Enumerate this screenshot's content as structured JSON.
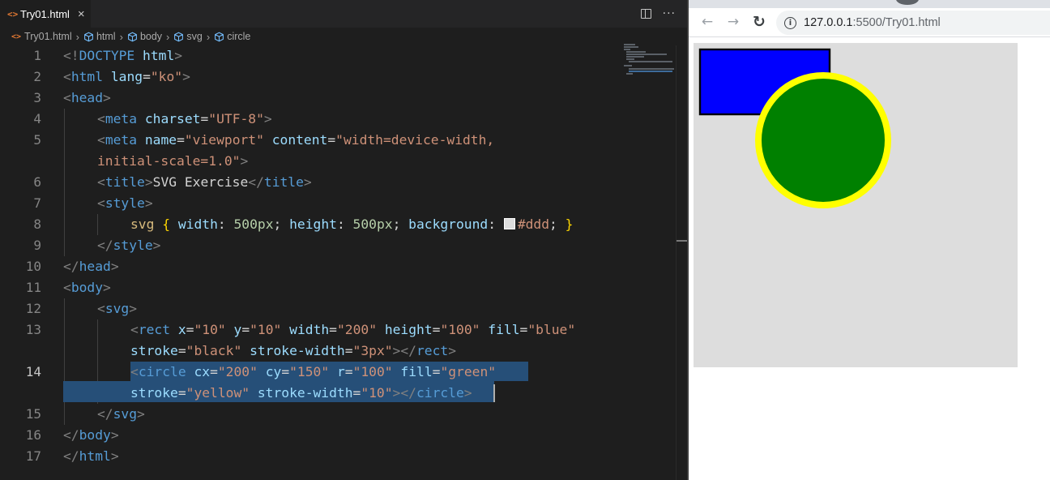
{
  "editor": {
    "tab": {
      "icon": "html-file-icon",
      "label": "Try01.html",
      "close": "×"
    },
    "actions": {
      "split": "split-editor-icon",
      "more": "···"
    },
    "breadcrumb": [
      {
        "label": "Try01.html",
        "icon": "html-file-icon"
      },
      {
        "label": "html",
        "icon": "element-cube-icon"
      },
      {
        "label": "body",
        "icon": "element-cube-icon"
      },
      {
        "label": "svg",
        "icon": "element-cube-icon"
      },
      {
        "label": "circle",
        "icon": "element-cube-icon"
      }
    ],
    "line_numbers": [
      "1",
      "2",
      "3",
      "4",
      "5",
      "6",
      "7",
      "8",
      "9",
      "10",
      "11",
      "12",
      "13",
      "14",
      "15",
      "16",
      "17"
    ],
    "code": {
      "l1": {
        "a": "<!",
        "b": "DOCTYPE",
        "c": " ",
        "d": "html",
        "e": ">"
      },
      "l2": {
        "a": "<",
        "b": "html",
        "c": " ",
        "d": "lang",
        "e": "=",
        "f": "\"ko\"",
        "g": ">"
      },
      "l3": {
        "a": "<",
        "b": "head",
        "c": ">"
      },
      "l4": {
        "a": "<",
        "b": "meta",
        "c": " ",
        "d": "charset",
        "e": "=",
        "f": "\"UTF-8\"",
        "g": ">"
      },
      "l5": {
        "a": "<",
        "b": "meta",
        "c": " ",
        "d": "name",
        "e": "=",
        "f": "\"viewport\"",
        "g": " ",
        "h": "content",
        "i": "=",
        "j": "\"width=device-width,",
        "k": "initial-scale=1.0\"",
        "l": ">"
      },
      "l6": {
        "a": "<",
        "b": "title",
        "c": ">",
        "d": "SVG Exercise",
        "e": "</",
        "f": "title",
        "g": ">"
      },
      "l7": {
        "a": "<",
        "b": "style",
        "c": ">"
      },
      "l8": {
        "a": "svg",
        "b": " ",
        "c": "{",
        "d": " ",
        "e": "width",
        "f": ": ",
        "g": "500px",
        "h": "; ",
        "i": "height",
        "j": ": ",
        "k": "500px",
        "l": "; ",
        "m": "background",
        "n": ": ",
        "o": "#ddd",
        "p": "; ",
        "q": "}"
      },
      "l9": {
        "a": "</",
        "b": "style",
        "c": ">"
      },
      "l10": {
        "a": "</",
        "b": "head",
        "c": ">"
      },
      "l11": {
        "a": "<",
        "b": "body",
        "c": ">"
      },
      "l12": {
        "a": "<",
        "b": "svg",
        "c": ">"
      },
      "l13": {
        "a": "<",
        "b": "rect",
        "c": " ",
        "d": "x",
        "e": "=",
        "f": "\"10\"",
        "g": " ",
        "h": "y",
        "i": "=",
        "j": "\"10\"",
        "k": " ",
        "l": "width",
        "m": "=",
        "n": "\"200\"",
        "o": " ",
        "p": "height",
        "q": "=",
        "r": "\"100\"",
        "s": " ",
        "t": "fill",
        "u": "=",
        "v": "\"blue\""
      },
      "l13b": {
        "a": "stroke",
        "b": "=",
        "c": "\"black\"",
        "d": " ",
        "e": "stroke-width",
        "f": "=",
        "g": "\"3px\"",
        "h": "></",
        "i": "rect",
        "j": ">"
      },
      "l14": {
        "a": "<",
        "b": "circle",
        "c": " ",
        "d": "cx",
        "e": "=",
        "f": "\"200\"",
        "g": " ",
        "h": "cy",
        "i": "=",
        "j": "\"150\"",
        "k": " ",
        "l": "r",
        "m": "=",
        "n": "\"100\"",
        "o": " ",
        "p": "fill",
        "q": "=",
        "r": "\"green\""
      },
      "l14b": {
        "a": "stroke",
        "b": "=",
        "c": "\"yellow\"",
        "d": " ",
        "e": "stroke-width",
        "f": "=",
        "g": "\"10\"",
        "h": "></",
        "i": "circle",
        "j": ">"
      },
      "l15": {
        "a": "</",
        "b": "svg",
        "c": ">"
      },
      "l16": {
        "a": "</",
        "b": "body",
        "c": ">"
      },
      "l17": {
        "a": "</",
        "b": "html",
        "c": ">"
      }
    },
    "colors": {
      "background": "#1e1e1e",
      "tag": "#569cd6",
      "attribute": "#9cdcfe",
      "string": "#ce9178",
      "selection": "#264f78",
      "swatch": "#dddddd"
    }
  },
  "browser": {
    "back_icon": "arrow-back-icon",
    "forward_icon": "arrow-forward-icon",
    "reload_icon": "reload-icon",
    "info_icon": "site-info-icon",
    "url_host": "127.0.0.1",
    "url_path": ":5500/Try01.html",
    "glyphs": {
      "back": "←",
      "forward": "→",
      "reload": "↻",
      "info": "i"
    },
    "svg_render": {
      "background": "#dddddd",
      "rect": {
        "fill": "#0000ff",
        "stroke": "#000000"
      },
      "circle": {
        "fill": "#008000",
        "stroke": "#ffff00"
      }
    }
  }
}
